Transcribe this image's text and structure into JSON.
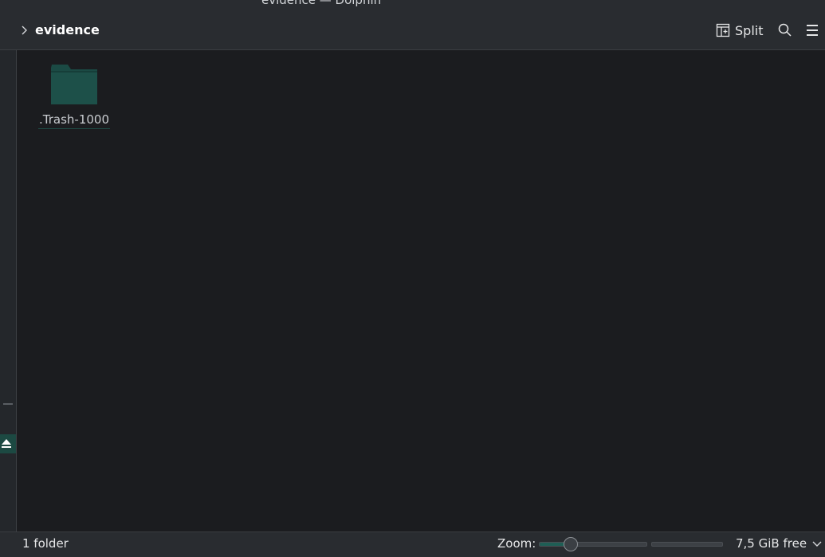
{
  "window": {
    "title": "evidence — Dolphin"
  },
  "breadcrumb": {
    "current": "evidence"
  },
  "toolbar": {
    "split_label": "Split"
  },
  "files": [
    {
      "name": ".Trash-1000",
      "type": "folder"
    }
  ],
  "statusbar": {
    "item_count": "1 folder",
    "zoom_label": "Zoom:",
    "zoom_level": 0.28,
    "free_space": "7,5 GiB free"
  },
  "colors": {
    "accent": "#1f5e55",
    "folder": "#1d4d47",
    "background": "#1b1c1f",
    "chrome": "#292c30"
  },
  "icons": [
    "chevron-right-icon",
    "split-view-icon",
    "search-icon",
    "hamburger-menu-icon",
    "folder-icon",
    "eject-icon",
    "chevron-down-icon"
  ]
}
